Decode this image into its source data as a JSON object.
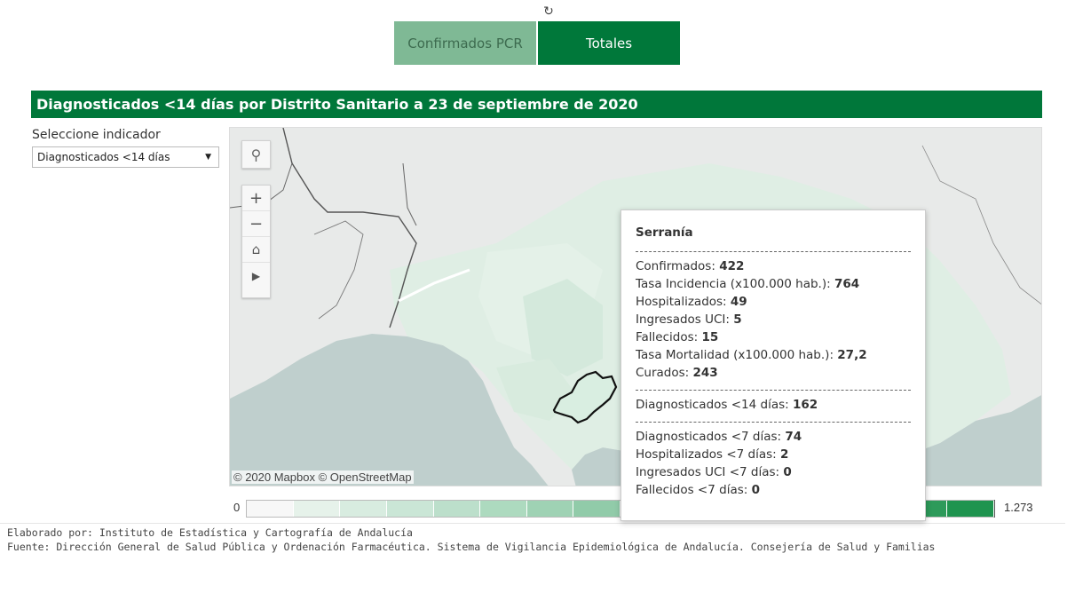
{
  "header": {
    "reload_icon": "reload-icon",
    "tabs": [
      {
        "label": "Confirmados PCR",
        "active": false
      },
      {
        "label": "Totales",
        "active": true
      }
    ]
  },
  "title": "Diagnosticados <14 días por Distrito Sanitario a 23 de septiembre de 2020",
  "selector": {
    "label": "Seleccione indicador",
    "value": "Diagnosticados <14 días"
  },
  "map": {
    "attribution": "© 2020 Mapbox © OpenStreetMap",
    "selected_region": "Serranía",
    "controls": [
      "search-icon",
      "zoom-in-icon",
      "zoom-out-icon",
      "home-icon",
      "play-icon"
    ]
  },
  "legend": {
    "min": "0",
    "max": "1.273",
    "colors": [
      "#f7f7f7",
      "#e6f2ea",
      "#d8ece0",
      "#cae6d6",
      "#bcdfcb",
      "#addabf",
      "#9fd2b4",
      "#91cba9",
      "#83c49d",
      "#74bd92",
      "#66b687",
      "#58af7c",
      "#49a870",
      "#3ba165",
      "#2d9a5a",
      "#1f944f"
    ]
  },
  "tooltip": {
    "title": "Serranía",
    "group1": [
      {
        "label": "Confirmados: ",
        "value": "422"
      },
      {
        "label": "Tasa Incidencia (x100.000 hab.): ",
        "value": "764"
      },
      {
        "label": "Hospitalizados: ",
        "value": "49"
      },
      {
        "label": "Ingresados UCI: ",
        "value": "5"
      },
      {
        "label": "Fallecidos: ",
        "value": "15"
      },
      {
        "label": "Tasa Mortalidad (x100.000 hab.): ",
        "value": "27,2"
      },
      {
        "label": "Curados: ",
        "value": "243"
      }
    ],
    "group2": [
      {
        "label": "Diagnosticados <14 días: ",
        "value": "162"
      }
    ],
    "group3": [
      {
        "label": "Diagnosticados <7 días: ",
        "value": "74"
      },
      {
        "label": "Hospitalizados <7 días: ",
        "value": "2"
      },
      {
        "label": "Ingresados UCI <7 días: ",
        "value": "0"
      },
      {
        "label": "Fallecidos <7 días: ",
        "value": "0"
      }
    ]
  },
  "footer": {
    "line1": "Elaborado por: Instituto de Estadística y Cartografía de Andalucía",
    "line2": "Fuente: Dirección General de Salud Pública y Ordenación Farmacéutica. Sistema de Vigilancia Epidemiológica de Andalucía. Consejería de Salud y Familias"
  }
}
